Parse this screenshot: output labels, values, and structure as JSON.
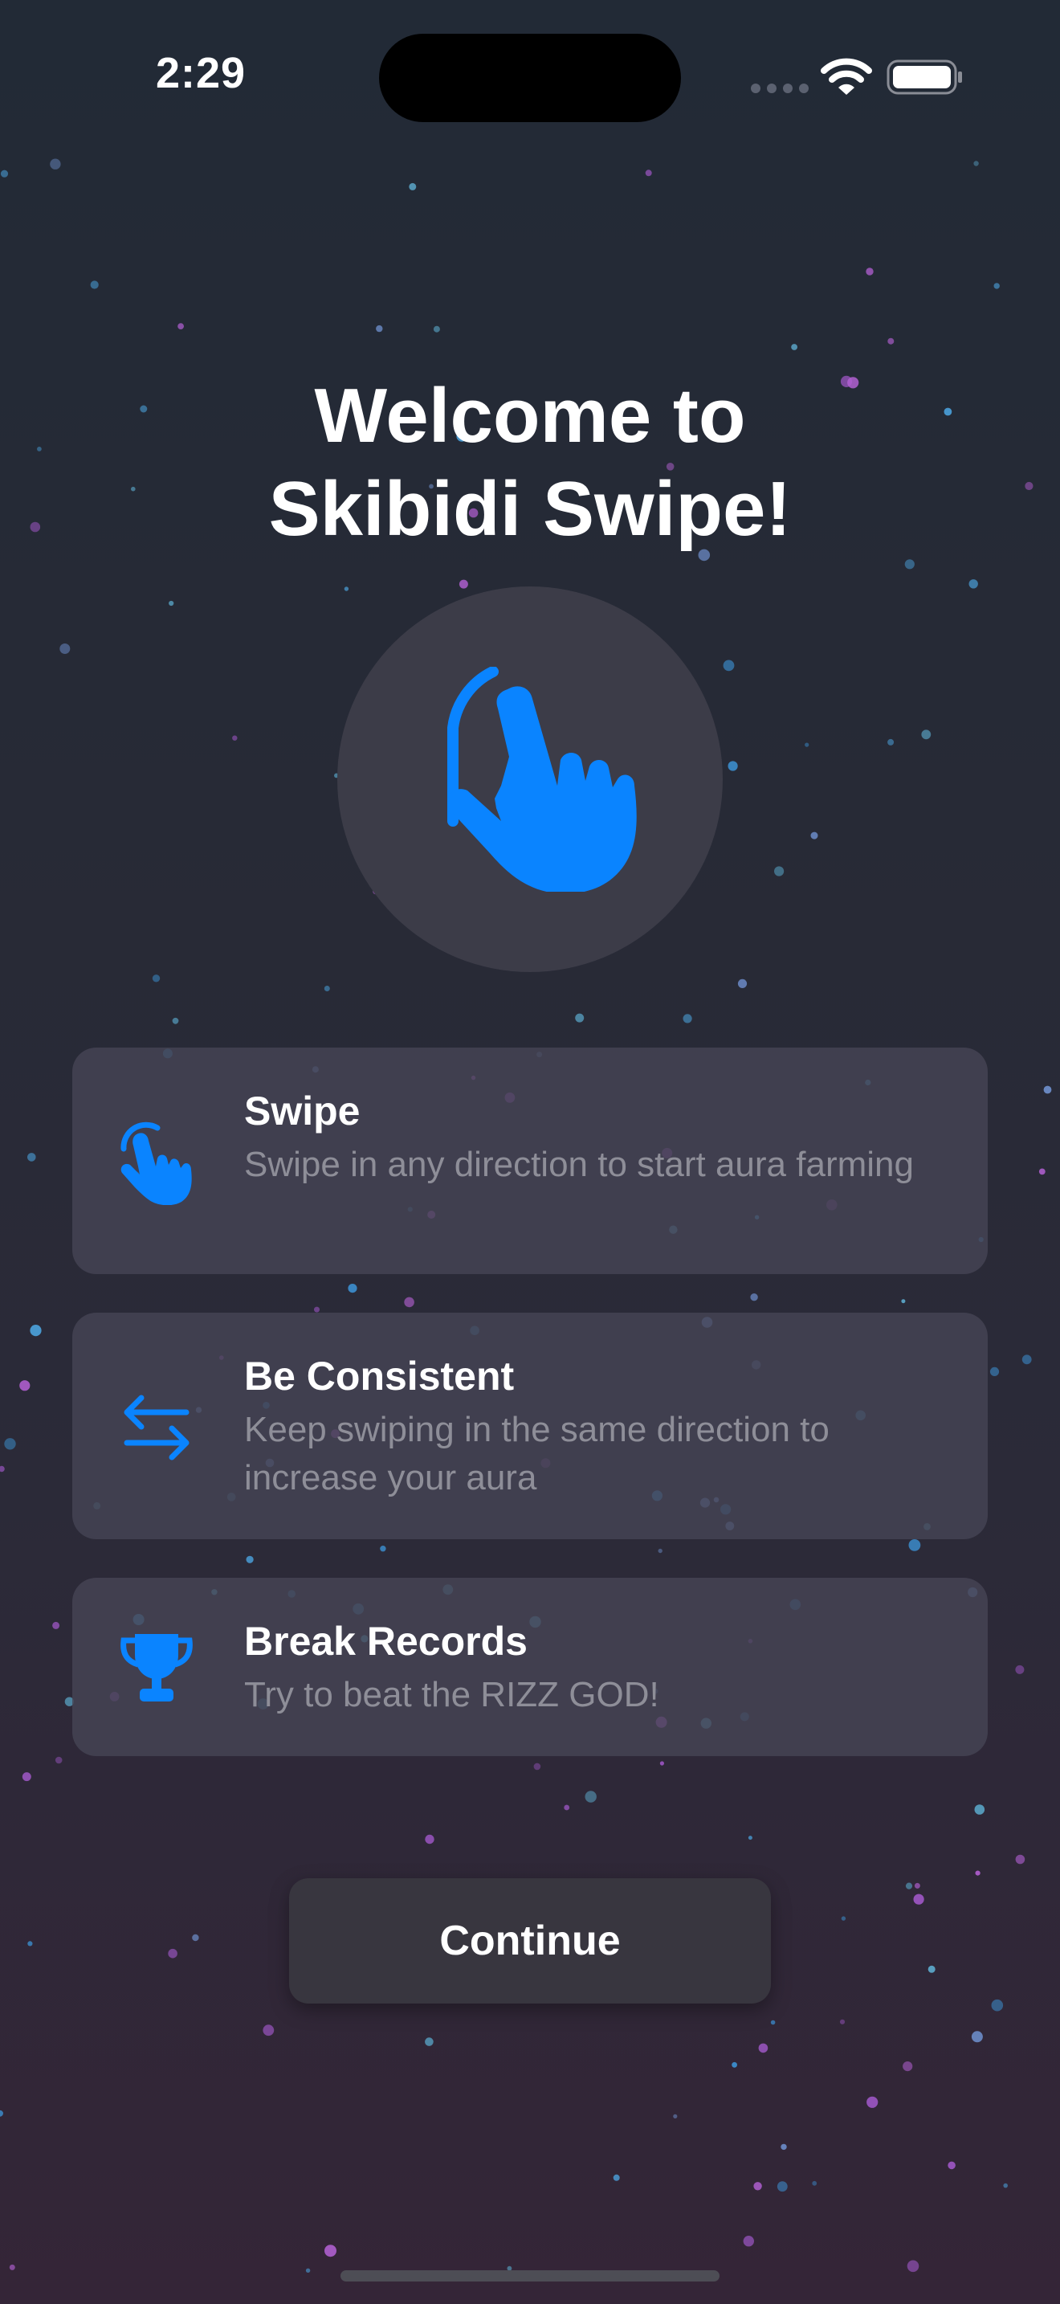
{
  "status_bar": {
    "time": "2:29"
  },
  "welcome": {
    "title_line1": "Welcome to",
    "title_line2": "Skibidi Swipe!",
    "hero_icon": "hand-tap-icon"
  },
  "features": [
    {
      "icon": "hand-tap-icon",
      "title": "Swipe",
      "description": "Swipe in any direction to start aura farming"
    },
    {
      "icon": "arrows-left-right-icon",
      "title": "Be Consistent",
      "description": "Keep swiping in the same direction to increase your aura"
    },
    {
      "icon": "trophy-icon",
      "title": "Break Records",
      "description": "Try to beat the RIZZ GOD!"
    }
  ],
  "continue_label": "Continue",
  "colors": {
    "accent": "#0a84ff",
    "card_background": "#464454",
    "secondary_text": "#8e8e98"
  }
}
